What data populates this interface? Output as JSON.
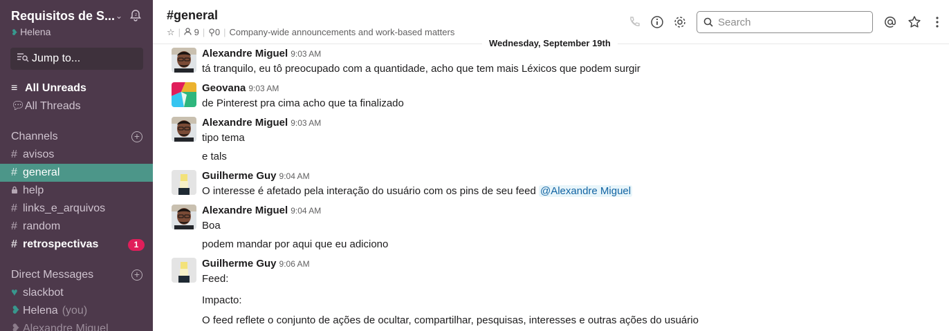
{
  "workspace": {
    "name": "Requisitos de S...",
    "user": "Helena"
  },
  "sidebar": {
    "jump_label": "Jump to...",
    "all_unreads": "All Unreads",
    "all_threads": "All Threads",
    "channels_header": "Channels",
    "channels": [
      {
        "name": "avisos",
        "prefix": "#"
      },
      {
        "name": "general",
        "prefix": "#"
      },
      {
        "name": "help",
        "prefix": "lock"
      },
      {
        "name": "links_e_arquivos",
        "prefix": "#"
      },
      {
        "name": "random",
        "prefix": "#"
      },
      {
        "name": "retrospectivas",
        "prefix": "#",
        "badge": "1"
      }
    ],
    "dm_header": "Direct Messages",
    "dms": [
      {
        "name": "slackbot"
      },
      {
        "name": "Helena",
        "suffix": "(you)"
      },
      {
        "name": "Alexandre Miguel"
      }
    ]
  },
  "header": {
    "title": "#general",
    "members": "9",
    "pins": "0",
    "topic": "Company-wide announcements and work-based matters",
    "search_placeholder": "Search"
  },
  "date_divider": "Wednesday, September 19th",
  "messages": [
    {
      "author": "Alexandre Miguel",
      "time": "9:03 AM",
      "lines": [
        "tá tranquilo, eu tô preocupado com a quantidade, acho que tem mais Léxicos que podem surgir"
      ]
    },
    {
      "author": "Geovana",
      "time": "9:03 AM",
      "lines": [
        "de Pinterest pra cima acho que ta finalizado"
      ]
    },
    {
      "author": "Alexandre Miguel",
      "time": "9:03 AM",
      "lines": [
        "tipo tema",
        "e tals"
      ]
    },
    {
      "author": "Guilherme Guy",
      "time": "9:04 AM",
      "lines": [
        "O interesse é afetado pela interação do usuário com os pins de seu feed"
      ],
      "mention": "@Alexandre Miguel"
    },
    {
      "author": "Alexandre Miguel",
      "time": "9:04 AM",
      "lines": [
        "Boa",
        "podem mandar por aqui que eu adiciono"
      ]
    },
    {
      "author": "Guilherme Guy",
      "time": "9:06 AM",
      "lines": [
        "Feed:",
        "Impacto:",
        "O feed reflete o conjunto de ações de ocultar, compartilhar, pesquisas, interesses e outras ações do usuário"
      ]
    }
  ],
  "colors": {
    "sidebar": "#4d394b",
    "active": "#4c9689",
    "badge": "#e01e5a",
    "mention": "#1264a3"
  }
}
